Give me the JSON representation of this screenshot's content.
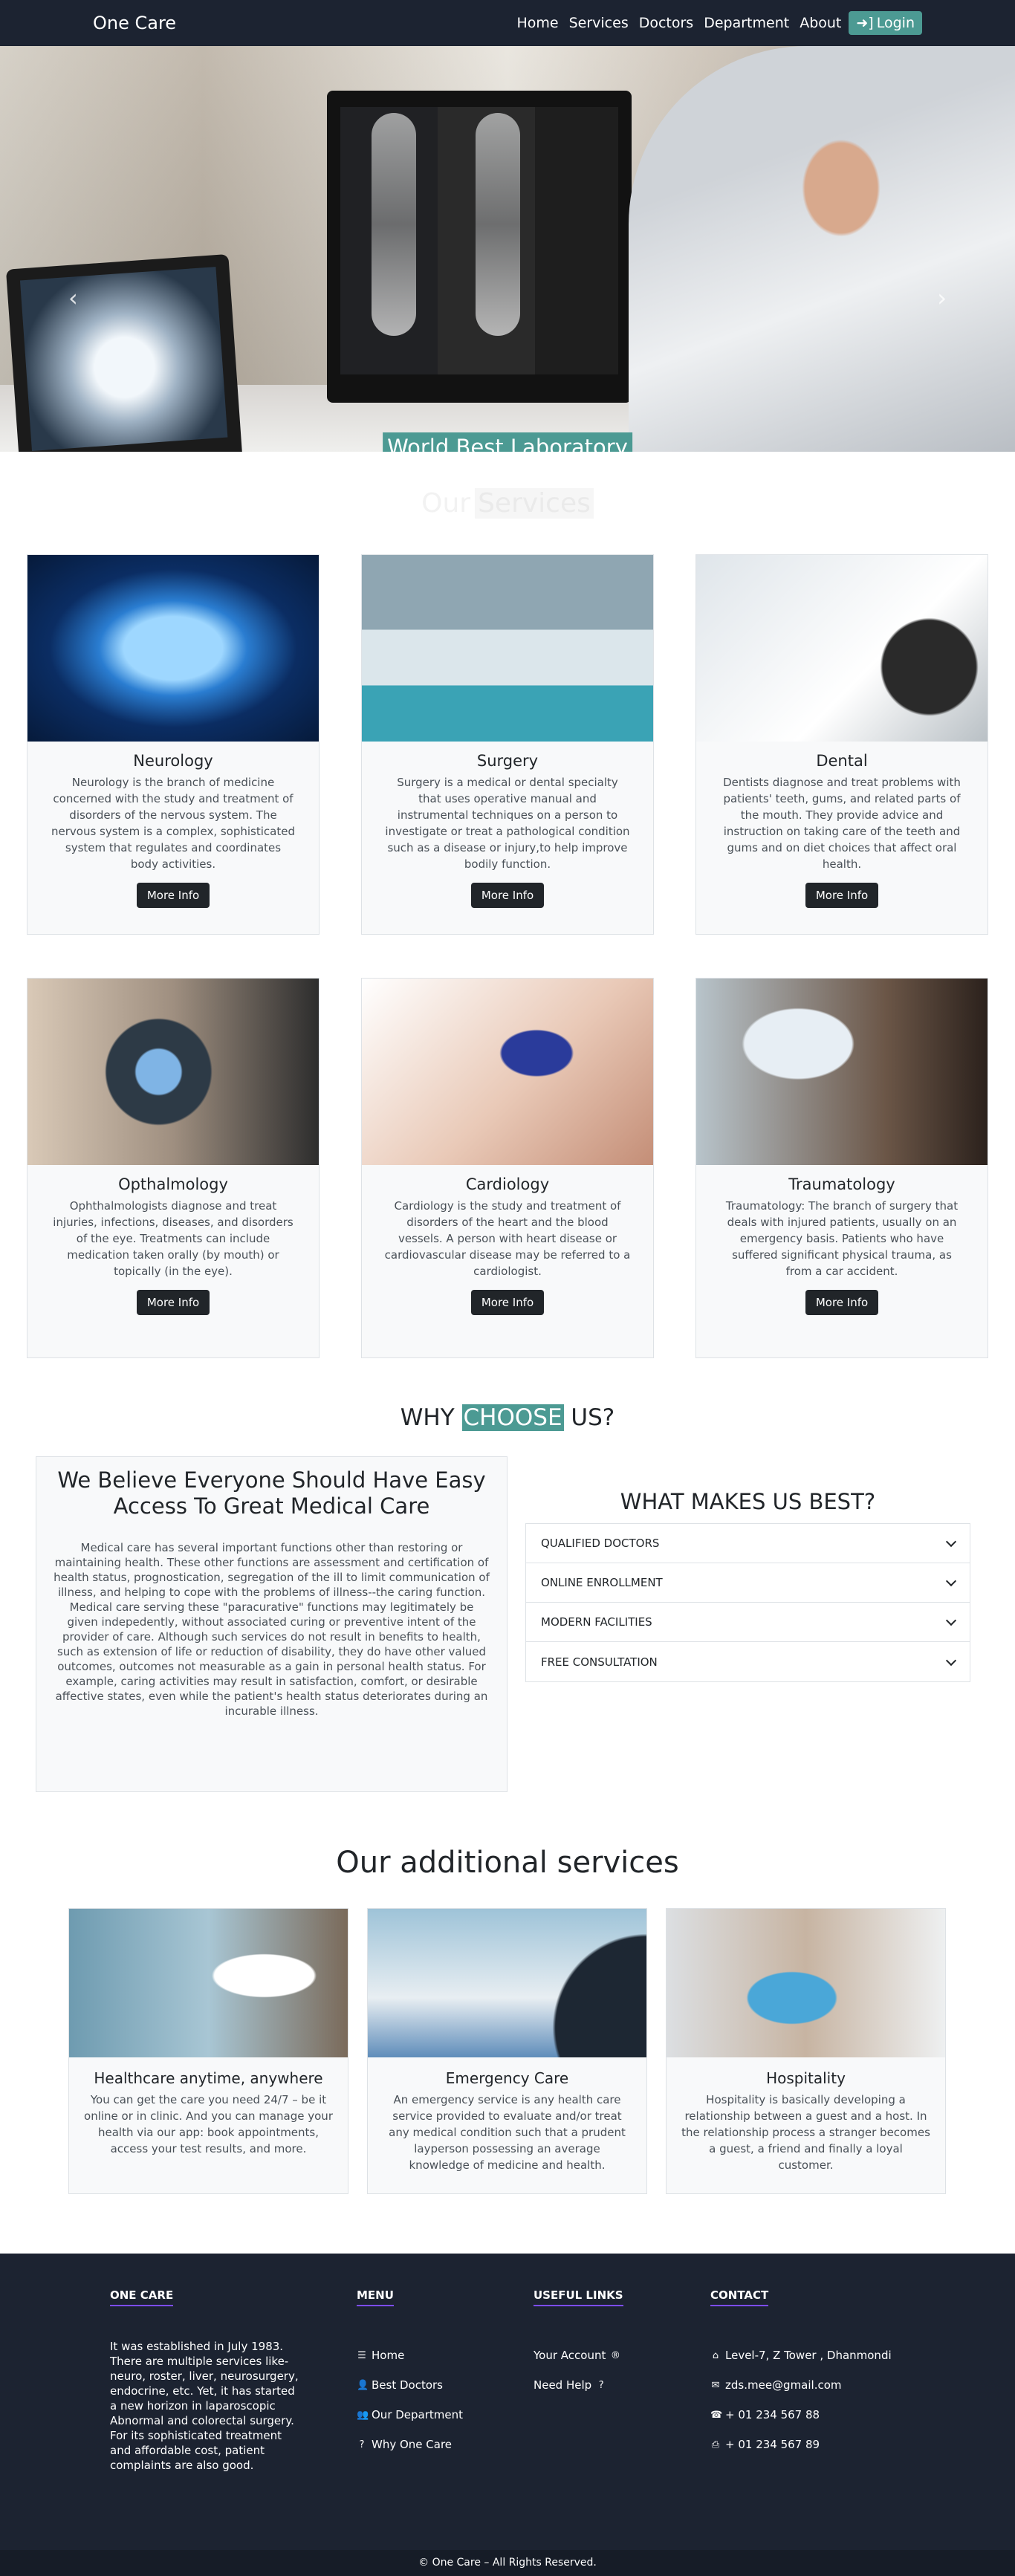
{
  "navbar": {
    "brand": "One Care",
    "links": [
      "Home",
      "Services",
      "Doctors",
      "Department",
      "About"
    ],
    "login_label": "Login",
    "login_icon": "sign-in-icon"
  },
  "hero": {
    "caption": "World Best Laboratory",
    "indicators": 3,
    "active_indicator": 1
  },
  "services": {
    "heading_part1": "Our",
    "heading_highlight": "Services",
    "cards": [
      {
        "title": "Neurology",
        "text": "Neurology is the branch of medicine concerned with the study and treatment of disorders of the nervous system. The nervous system is a complex, sophisticated system that regulates and coordinates body activities.",
        "button": "More Info"
      },
      {
        "title": "Surgery",
        "text": "Surgery is a medical or dental specialty that uses operative manual and instrumental techniques on a person to investigate or treat a pathological condition such as a disease or injury,to help improve bodily function.",
        "button": "More Info"
      },
      {
        "title": "Dental",
        "text": "Dentists diagnose and treat problems with patients' teeth, gums, and related parts of the mouth. They provide advice and instruction on taking care of the teeth and gums and on diet choices that affect oral health.",
        "button": "More Info"
      },
      {
        "title": "Opthalmology",
        "text": "Ophthalmologists diagnose and treat injuries, infections, diseases, and disorders of the eye. Treatments can include medication taken orally (by mouth) or topically (in the eye).",
        "button": "More Info"
      },
      {
        "title": "Cardiology",
        "text": "Cardiology is the study and treatment of disorders of the heart and the blood vessels. A person with heart disease or cardiovascular disease may be referred to a cardiologist.",
        "button": "More Info"
      },
      {
        "title": "Traumatology",
        "text": "Traumatology: The branch of surgery that deals with injured patients, usually on an emergency basis. Patients who have suffered significant physical trauma, as from a car accident.",
        "button": "More Info"
      }
    ]
  },
  "why": {
    "heading_before": "WHY",
    "heading_highlight": "CHOOSE",
    "heading_after": "US?",
    "believe_title": "We Believe Everyone Should Have Easy Access To Great Medical Care",
    "believe_text": "Medical care has several important functions other than restoring or maintaining health. These other functions are assessment and certification of health status, prognostication, segregation of the ill to limit communication of illness, and helping to cope with the problems of illness--the caring function. Medical care serving these \"paracurative\" functions may legitimately be given indepedently, without associated curing or preventive intent of the provider of care. Although such services do not result in benefits to health, such as extension of life or reduction of disability, they do have other valued outcomes, outcomes not measurable as a gain in personal health status. For example, caring activities may result in satisfaction, comfort, or desirable affective states, even while the patient's health status deteriorates during an incurable illness.",
    "best_title": "WHAT MAKES US BEST?",
    "accordion": [
      "QUALIFIED DOCTORS",
      "ONLINE ENROLLMENT",
      "MODERN FACILITIES",
      "FREE CONSULTATION"
    ]
  },
  "additional": {
    "heading": "Our additional services",
    "cards": [
      {
        "title": "Healthcare anytime, anywhere",
        "text": "You can get the care you need 24/7 – be it online or in clinic. And you can manage your health via our app: book appointments, access your test results, and more."
      },
      {
        "title": "Emergency Care",
        "text": "An emergency service is any health care service provided to evaluate and/or treat any medical condition such that a prudent layperson possessing an average knowledge of medicine and health."
      },
      {
        "title": "Hospitality",
        "text": "Hospitality is basically developing a relationship between a guest and a host. In the relationship process a stranger becomes a guest, a friend and finally a loyal customer."
      }
    ]
  },
  "footer": {
    "col1_title": "ONE CARE",
    "col1_text": "It was established in July 1983. There are multiple services like-neuro, roster, liver, neurosurgery, endocrine, etc. Yet, it has started a new horizon in laparoscopic Abnormal and colorectal surgery. For its sophisticated treatment and affordable cost, patient complaints are also good.",
    "menu_title": "MENU",
    "menu_items": [
      "Home",
      "Best Doctors",
      "Our Department",
      "Why One Care"
    ],
    "useful_title": "USEFUL LINKS",
    "useful_items": [
      "Your Account",
      "Need Help"
    ],
    "contact_title": "CONTACT",
    "contact_items": [
      "Level-7, Z Tower , Dhanmondi",
      "zds.mee@gmail.com",
      "+ 01 234 567 88",
      "+ 01 234 567 89"
    ],
    "copyright": "© One Care – All Rights Reserved."
  },
  "colors": {
    "navbar_bg": "#1c2331",
    "accent": "#4c9a93",
    "button_dark": "#212529",
    "card_bg": "#f8f9fa"
  }
}
